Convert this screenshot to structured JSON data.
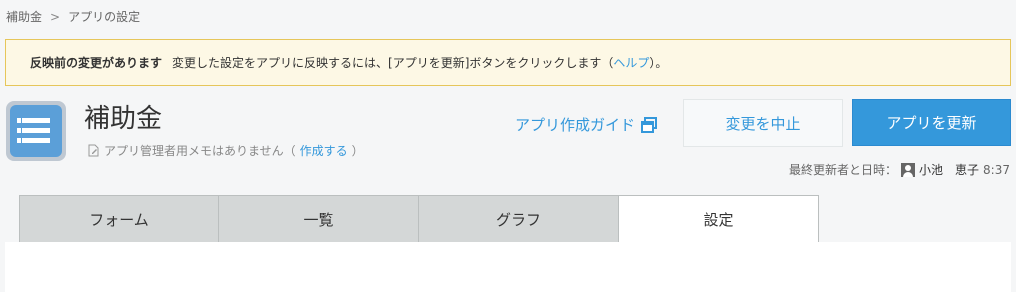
{
  "breadcrumb": {
    "items": [
      "補助金",
      "アプリの設定"
    ],
    "separator": ">"
  },
  "notice": {
    "title": "反映前の変更があります",
    "message_before": "変更した設定をアプリに反映するには、[アプリを更新]ボタンをクリックします（",
    "help_link": "ヘルプ",
    "message_after": "）。"
  },
  "app": {
    "name": "補助金",
    "memo_text": "アプリ管理者用メモはありません（",
    "memo_link": "作成する",
    "memo_close": "）"
  },
  "header": {
    "guide_link": "アプリ作成ガイド",
    "cancel_label": "変更を中止",
    "update_label": "アプリを更新"
  },
  "last_updated": {
    "label": "最終更新者と日時：",
    "user": "小池　恵子",
    "time": "8:37"
  },
  "tabs": [
    {
      "label": "フォーム",
      "active": false
    },
    {
      "label": "一覧",
      "active": false
    },
    {
      "label": "グラフ",
      "active": false
    },
    {
      "label": "設定",
      "active": true
    }
  ],
  "colors": {
    "accent": "#3498db",
    "notice_bg": "#fdf8e5",
    "notice_border": "#e6c65a",
    "tab_bg": "#d4d7d7"
  }
}
